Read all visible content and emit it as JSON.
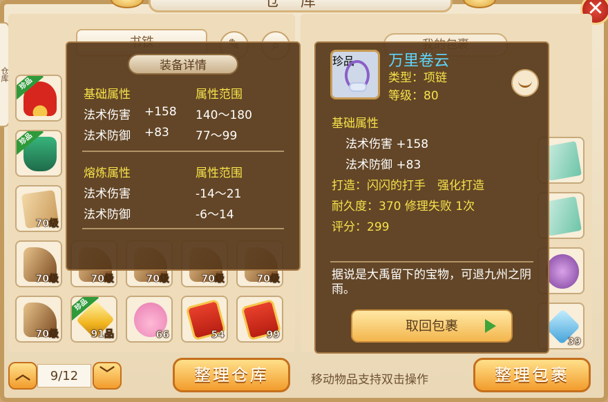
{
  "window": {
    "title": "仓库"
  },
  "side_tab": {
    "label": "仓库"
  },
  "storage": {
    "sort_label": "书铁",
    "page": "9/12",
    "organize_button": "整理仓库"
  },
  "bag": {
    "title": "我的包裹",
    "hint": "移动物品支持双击操作",
    "organize_button": "整理包裹"
  },
  "equipment_detail": {
    "heading": "装备详情",
    "basic_header": "基础属性",
    "basic_range_header": "属性范围",
    "basic_rows": [
      {
        "name": "法术伤害",
        "value": "+158",
        "range": "140～180"
      },
      {
        "name": "法术防御",
        "value": "+83",
        "range": "77～99"
      }
    ],
    "smelt_header": "熔炼属性",
    "smelt_range_header": "属性范围",
    "smelt_rows": [
      {
        "name": "法术伤害",
        "range": "-14～21"
      },
      {
        "name": "法术防御",
        "range": "-6～14"
      }
    ]
  },
  "item_tooltip": {
    "badge": "珍品",
    "name": "万里卷云",
    "type": "类型：项链",
    "level": "等级：80",
    "basic_header": "基础属性",
    "stats": [
      "法术伤害 +158",
      "法术防御 +83"
    ],
    "forge": "打造：闪闪的打手　强化打造",
    "durability": "耐久度：370 修理失败 1次",
    "score": "评分：299",
    "description": "据说是大禹留下的宝物，可退九州之阴雨。",
    "retrieve_button": "取回包裹"
  },
  "storage_slots": [
    {
      "art": "fan",
      "badge": "珍品",
      "label": ""
    },
    {
      "art": "boots",
      "badge": "珍品",
      "label": ""
    },
    {
      "art": "scroll",
      "badge": "",
      "label": "70级"
    },
    {
      "art": "scroll-dark",
      "badge": "",
      "label": "70级"
    },
    {
      "art": "scroll-dark",
      "badge": "",
      "label": "70级"
    },
    {
      "art": "scroll-dark",
      "badge": "",
      "label": "70级"
    },
    {
      "art": "scroll-dark",
      "badge": "",
      "label": "70级"
    },
    {
      "art": "scroll-dark",
      "badge": "",
      "label": "70级"
    },
    {
      "art": "scroll-dark",
      "badge": "",
      "label": "70级"
    },
    {
      "art": "crystal",
      "badge": "珍品",
      "label": "91品"
    },
    {
      "art": "pig",
      "badge": "",
      "label": "66"
    },
    {
      "art": "chest",
      "badge": "",
      "label": "54"
    },
    {
      "art": "chest",
      "badge": "",
      "label": "99"
    }
  ],
  "bag_slots": [
    {
      "art": "ticket",
      "label": ""
    },
    {
      "art": "ticket",
      "label": ""
    },
    {
      "art": "purple",
      "label": ""
    },
    {
      "art": "ice",
      "label": "39"
    }
  ]
}
